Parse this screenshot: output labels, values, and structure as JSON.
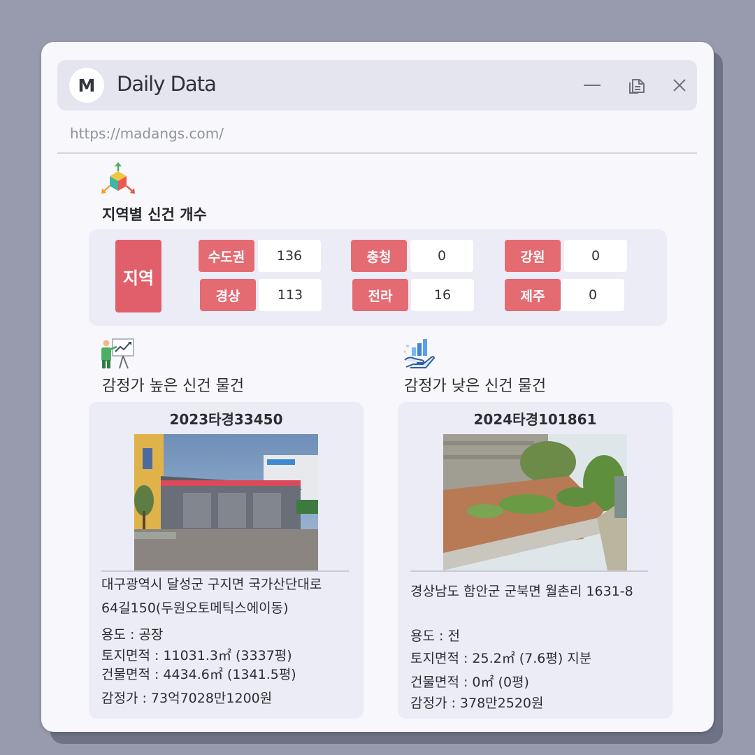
{
  "window": {
    "logo_letter": "M",
    "title": "Daily Data",
    "url": "https://madangs.com/"
  },
  "region_section": {
    "title": "지역별 신건 개수",
    "icon": "cube-arrows-icon",
    "main_label": "지역",
    "regions": [
      {
        "label": "수도권",
        "count": "136"
      },
      {
        "label": "충청",
        "count": "0"
      },
      {
        "label": "강원",
        "count": "0"
      },
      {
        "label": "경상",
        "count": "113"
      },
      {
        "label": "전라",
        "count": "16"
      },
      {
        "label": "제주",
        "count": "0"
      }
    ]
  },
  "high_section": {
    "title": "감정가 높은 신건 물건",
    "icon": "presentation-chart-icon",
    "case_no": "2023타경33450",
    "address_line1": "대구광역시 달성군 구지면 국가산단대로",
    "address_line2": "64길150(두원오토메틱스에이동)",
    "usage": "용도 : 공장",
    "land_area": "토지면적 : 11031.3㎡ (3337평)",
    "building_area": "건물면적 : 4434.6㎡ (1341.5평)",
    "appraisal": "감정가 : 73억7028만1200원"
  },
  "low_section": {
    "title": "감정가 낮은 신건 물건",
    "icon": "hand-chart-icon",
    "case_no": "2024타경101861",
    "address_line1": "경상남도 함안군 군북면 월촌리 1631-8",
    "usage": "용도 :  전",
    "land_area": "토지면적 : 25.2㎡ (7.6평) 지분",
    "building_area": "건물면적 : 0㎡ (0평)",
    "appraisal": "감정가 : 378만2520원"
  },
  "colors": {
    "background": "#989bad",
    "region_chip": "#e56b73",
    "region_main": "#e05f6a",
    "panel": "#ececf6"
  }
}
